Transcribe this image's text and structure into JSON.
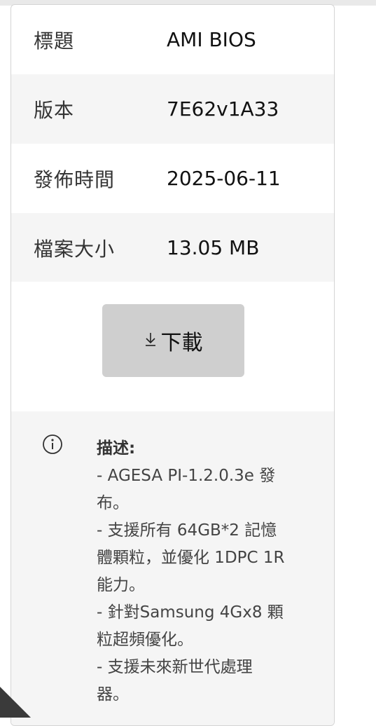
{
  "details": [
    {
      "label": "標題",
      "value": "AMI BIOS"
    },
    {
      "label": "版本",
      "value": "7E62v1A33"
    },
    {
      "label": "發佈時間",
      "value": "2025-06-11"
    },
    {
      "label": "檔案大小",
      "value": "13.05 MB"
    }
  ],
  "download": {
    "icon": "download-arrow-icon",
    "label": "下載"
  },
  "description": {
    "icon": "info-icon",
    "title": "描述:",
    "lines": [
      "- AGESA PI-1.2.0.3e 發",
      "布。",
      "- 支援所有 64GB*2 記憶",
      "體顆粒，並優化 1DPC 1R",
      "能力。",
      "- 針對Samsung 4Gx8 顆",
      "粒超頻優化。",
      "- 支援未來新世代處理",
      "器。"
    ]
  },
  "colors": {
    "row_alt": "#f5f5f5",
    "button_bg": "#cfcfcf",
    "border": "#d4d4d4"
  }
}
